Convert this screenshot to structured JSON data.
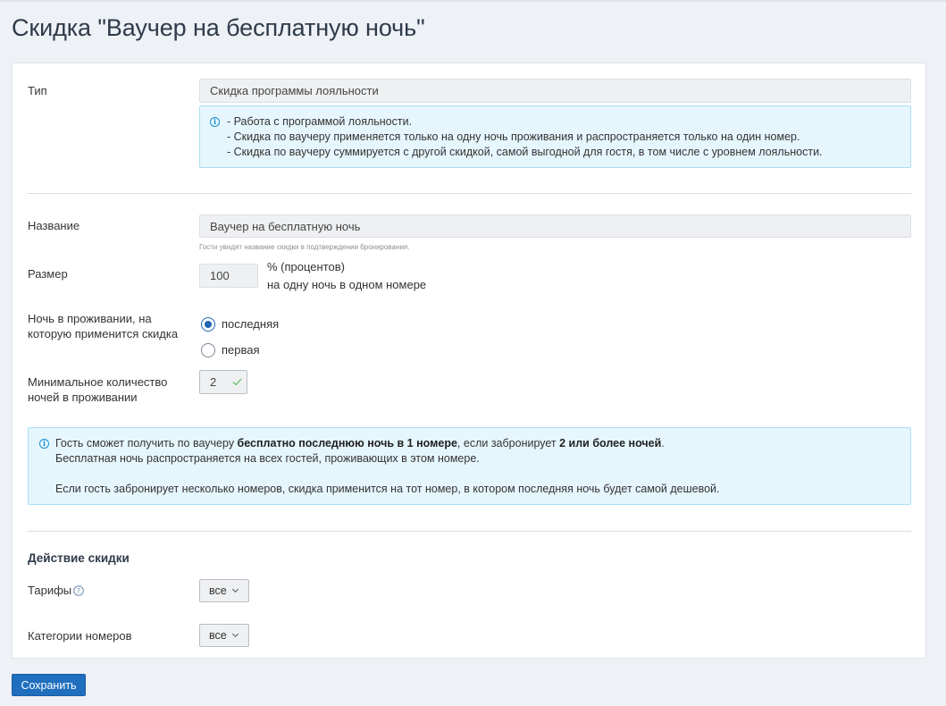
{
  "page": {
    "title": "Скидка \"Ваучер на бесплатную ночь\""
  },
  "type_section": {
    "label": "Тип",
    "value": "Скидка программы лояльности",
    "info_lines": [
      "- Работа с программой лояльности.",
      "- Скидка по ваучеру применяется только на одну ночь проживания и распространяется только на один номер.",
      "- Скидка по ваучеру суммируется с другой скидкой, самой выгодной для гостя, в том числе с уровнем лояльности."
    ]
  },
  "name_section": {
    "label": "Название",
    "value": "Ваучер на бесплатную ночь",
    "hint": "Гости увидят название скидки в подтверждении бронирования."
  },
  "size_section": {
    "label": "Размер",
    "value": "100",
    "unit_line1": "% (процентов)",
    "unit_line2": "на одну ночь в одном номере"
  },
  "night_section": {
    "label_line1": "Ночь в проживании, на",
    "label_line2": "которую применится скидка",
    "options": [
      {
        "label": "последняя",
        "checked": true
      },
      {
        "label": "первая",
        "checked": false
      }
    ]
  },
  "min_nights_section": {
    "label_line1": "Минимальное количество",
    "label_line2": "ночей в проживании",
    "value": "2"
  },
  "summary_info": {
    "line1_part1": "Гость сможет получить по ваучеру ",
    "line1_bold1": "бесплатно последнюю ночь в 1 номере",
    "line1_part2": ", если забронирует ",
    "line1_bold2": "2 или более ночей",
    "line1_part3": ".",
    "line2": "Бесплатная ночь распространяется на всех гостей, проживающих в этом номере.",
    "line3": "Если гость забронирует несколько номеров, скидка применится на тот номер, в котором последняя ночь будет самой дешевой."
  },
  "action_section": {
    "heading": "Действие скидки",
    "tariffs_label": "Тарифы",
    "tariffs_value": "все",
    "categories_label": "Категории номеров",
    "categories_value": "все"
  },
  "footer": {
    "save_label": "Сохранить"
  },
  "colors": {
    "accent": "#1f6fbe",
    "info_bg": "#e6f6fd",
    "info_border": "#a9def3",
    "success_check": "#5cb85c"
  }
}
